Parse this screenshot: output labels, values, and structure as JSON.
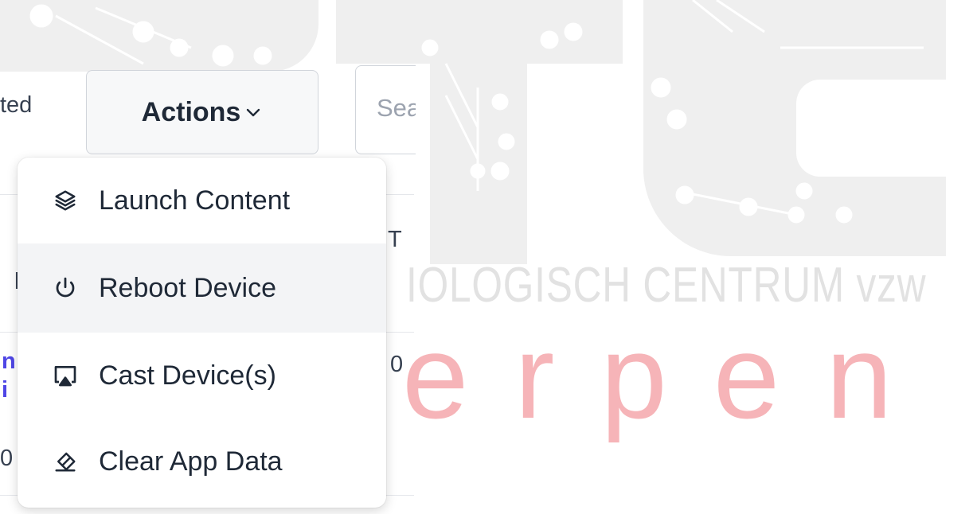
{
  "toolbar": {
    "fragment_left": "ted",
    "actions_label": "Actions",
    "search_placeholder": "Search"
  },
  "table": {
    "header_fragment": "T",
    "row_fragments": [
      "l",
      "n",
      "i",
      "0",
      "0"
    ]
  },
  "menu": {
    "items": [
      {
        "label": "Launch Content",
        "icon": "layers-icon"
      },
      {
        "label": "Reboot Device",
        "icon": "power-icon"
      },
      {
        "label": "Cast Device(s)",
        "icon": "cast-icon"
      },
      {
        "label": "Clear App Data",
        "icon": "eraser-icon"
      }
    ],
    "hovered_index": 1
  },
  "watermark": {
    "subtitle": "IOLOGISCH CENTRUM vzw",
    "brand": "erpen"
  },
  "colors": {
    "link": "#4f46e5",
    "watermark_brand": "#f6b4b8",
    "hover_bg": "#f3f4f6"
  }
}
